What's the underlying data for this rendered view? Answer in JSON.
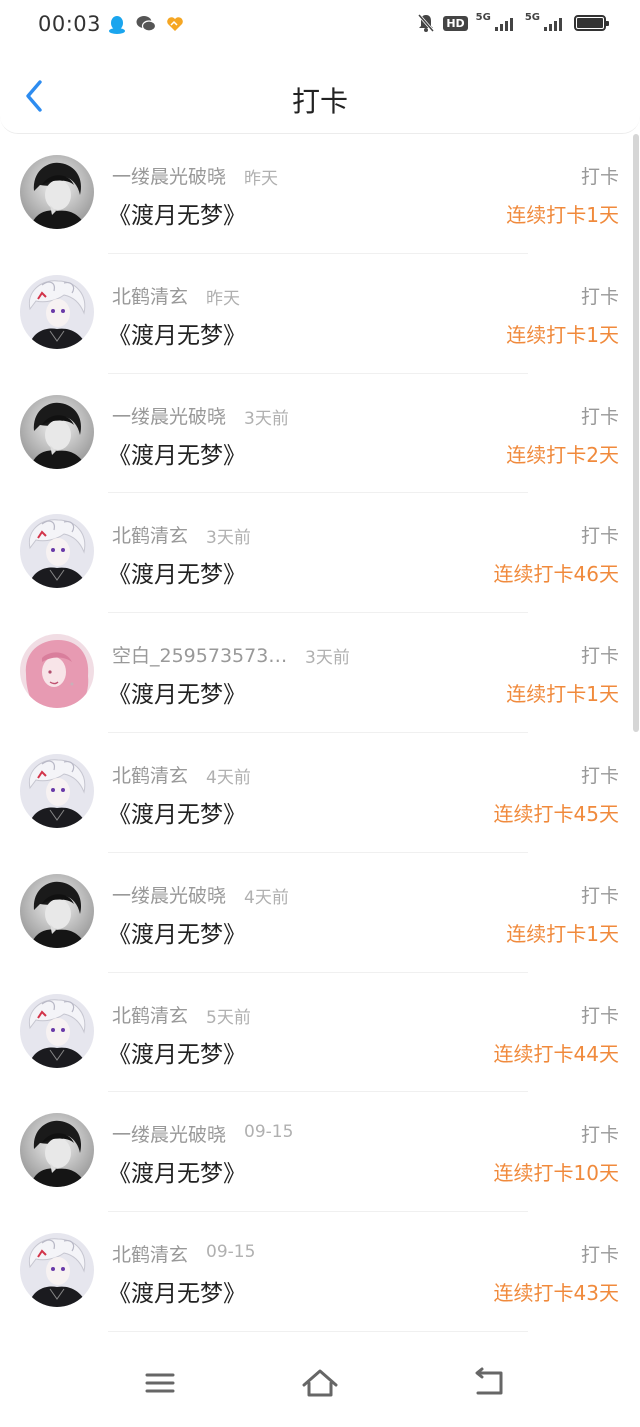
{
  "status_bar": {
    "time": "00:03",
    "app_icons": [
      "qq-icon",
      "wechat-icon",
      "heart-app-icon"
    ],
    "hd": "HD",
    "network_1": "5G",
    "network_2": "5G"
  },
  "header": {
    "title": "打卡"
  },
  "colors": {
    "accent_blue": "#2d8cf0",
    "streak_orange": "#f08a3c"
  },
  "items": [
    {
      "user": "一缕晨光破晓",
      "time": "昨天",
      "book": "《渡月无梦》",
      "action": "打卡",
      "streak": "连续打卡1天",
      "avatar": "avatar-dark"
    },
    {
      "user": "北鹤清玄",
      "time": "昨天",
      "book": "《渡月无梦》",
      "action": "打卡",
      "streak": "连续打卡1天",
      "avatar": "avatar-white-hair"
    },
    {
      "user": "一缕晨光破晓",
      "time": "3天前",
      "book": "《渡月无梦》",
      "action": "打卡",
      "streak": "连续打卡2天",
      "avatar": "avatar-dark"
    },
    {
      "user": "北鹤清玄",
      "time": "3天前",
      "book": "《渡月无梦》",
      "action": "打卡",
      "streak": "连续打卡46天",
      "avatar": "avatar-white-hair"
    },
    {
      "user": "空白_259573573…",
      "time": "3天前",
      "book": "《渡月无梦》",
      "action": "打卡",
      "streak": "连续打卡1天",
      "avatar": "avatar-pink"
    },
    {
      "user": "北鹤清玄",
      "time": "4天前",
      "book": "《渡月无梦》",
      "action": "打卡",
      "streak": "连续打卡45天",
      "avatar": "avatar-white-hair"
    },
    {
      "user": "一缕晨光破晓",
      "time": "4天前",
      "book": "《渡月无梦》",
      "action": "打卡",
      "streak": "连续打卡1天",
      "avatar": "avatar-dark"
    },
    {
      "user": "北鹤清玄",
      "time": "5天前",
      "book": "《渡月无梦》",
      "action": "打卡",
      "streak": "连续打卡44天",
      "avatar": "avatar-white-hair"
    },
    {
      "user": "一缕晨光破晓",
      "time": "09-15",
      "book": "《渡月无梦》",
      "action": "打卡",
      "streak": "连续打卡10天",
      "avatar": "avatar-dark"
    },
    {
      "user": "北鹤清玄",
      "time": "09-15",
      "book": "《渡月无梦》",
      "action": "打卡",
      "streak": "连续打卡43天",
      "avatar": "avatar-white-hair"
    }
  ],
  "nav": {
    "buttons": [
      "menu-icon",
      "home-icon",
      "back-nav-icon"
    ]
  }
}
